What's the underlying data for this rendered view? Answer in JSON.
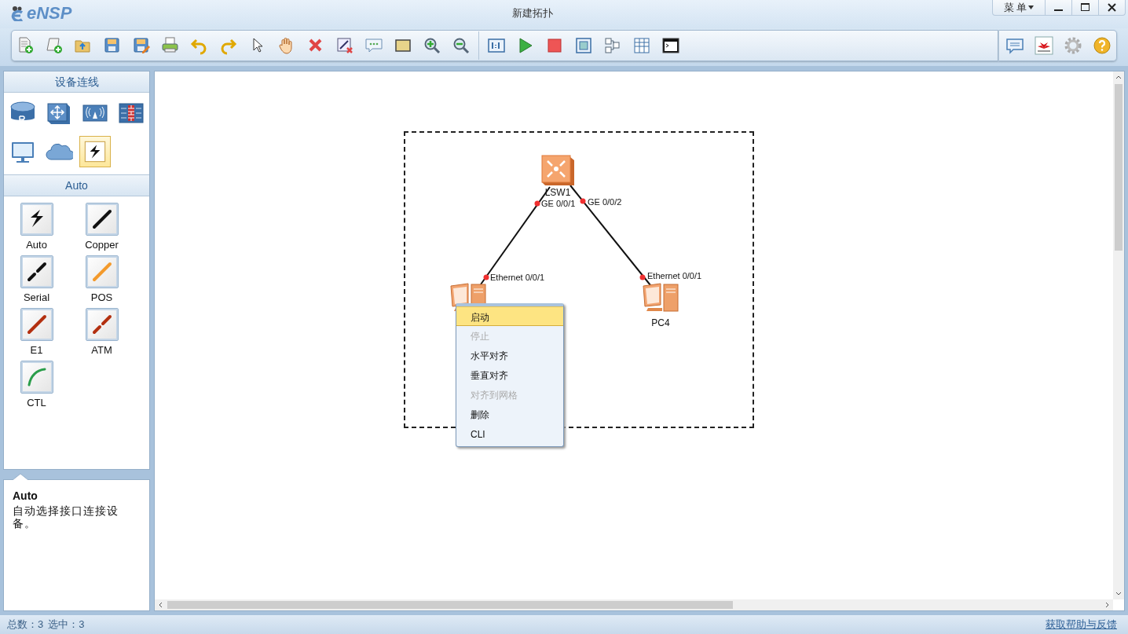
{
  "app": {
    "logo": "eNSP"
  },
  "window": {
    "title": "新建拓扑",
    "menu": "菜 单"
  },
  "palette": {
    "title": "设备连线",
    "devices": [
      {
        "kind": "router",
        "selected": false
      },
      {
        "kind": "switch",
        "selected": false
      },
      {
        "kind": "wireless",
        "selected": false
      },
      {
        "kind": "firewall",
        "selected": false
      },
      {
        "kind": "pc",
        "selected": false
      },
      {
        "kind": "cloud",
        "selected": false
      },
      {
        "kind": "cable",
        "selected": true
      }
    ],
    "section": "Auto",
    "cables": [
      {
        "kind": "auto",
        "label": "Auto"
      },
      {
        "kind": "copper",
        "label": "Copper"
      },
      {
        "kind": "serial",
        "label": "Serial"
      },
      {
        "kind": "pos",
        "label": "POS"
      },
      {
        "kind": "e1",
        "label": "E1"
      },
      {
        "kind": "atm",
        "label": "ATM"
      },
      {
        "kind": "ctl",
        "label": "CTL"
      }
    ],
    "description": {
      "title": "Auto",
      "text": "自动选择接口连接设备。"
    }
  },
  "canvas": {
    "nodes": [
      {
        "kind": "switch",
        "label": "LSW1"
      },
      {
        "kind": "pc"
      },
      {
        "kind": "pc",
        "label": "PC4"
      }
    ],
    "links": [
      {
        "from_port": "GE 0/0/1",
        "to_port": "Ethernet 0/0/1"
      },
      {
        "from_port": "GE 0/0/2",
        "to_port": "Ethernet 0/0/1"
      }
    ],
    "context_menu": [
      {
        "label": "启动",
        "disabled": false,
        "selected": true
      },
      {
        "label": "停止",
        "disabled": true,
        "selected": false
      },
      {
        "label": "水平对齐",
        "disabled": false,
        "selected": false
      },
      {
        "label": "垂直对齐",
        "disabled": false,
        "selected": false
      },
      {
        "label": "对齐到网格",
        "disabled": true,
        "selected": false
      },
      {
        "label": "删除",
        "disabled": false,
        "selected": false
      },
      {
        "label": "CLI",
        "disabled": false,
        "selected": false
      }
    ]
  },
  "status_bar": {
    "total": "总数：3",
    "selected": "选中：3",
    "help_link": "获取帮助与反馈"
  }
}
